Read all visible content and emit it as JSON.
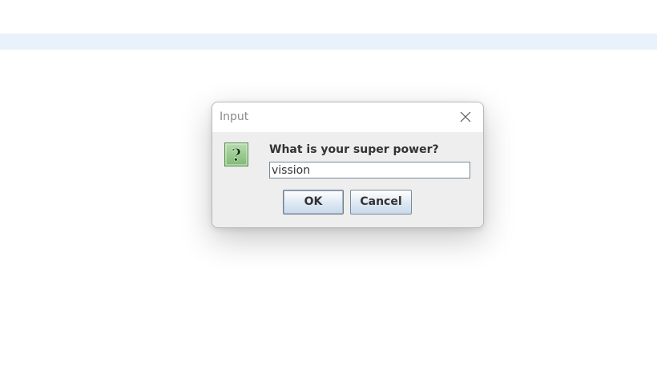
{
  "dialog": {
    "title": "Input",
    "prompt": "What is your super power?",
    "input_value": "vission",
    "ok_label": "OK",
    "cancel_label": "Cancel",
    "icon": "question-icon",
    "close_icon": "close-icon"
  }
}
